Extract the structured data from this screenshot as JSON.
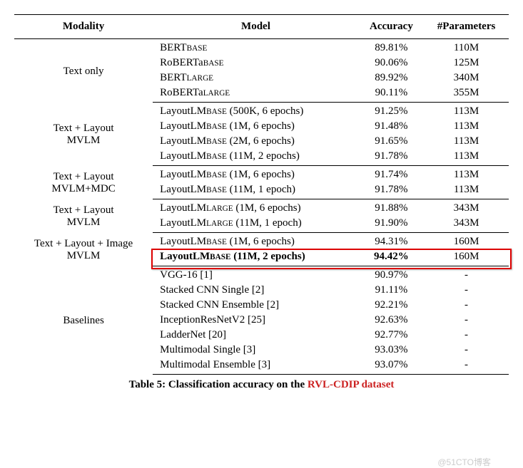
{
  "chart_data": {
    "type": "table",
    "columns": [
      "Modality",
      "Model",
      "Accuracy",
      "#Parameters"
    ],
    "groups": [
      {
        "modality": "Text only",
        "rows": [
          {
            "model_base": "BERT",
            "model_sub": "BASE",
            "detail": "",
            "acc": "89.81%",
            "params": "110M"
          },
          {
            "model_base": "RoBERTa",
            "model_sub": "BASE",
            "detail": "",
            "acc": "90.06%",
            "params": "125M"
          },
          {
            "model_base": "BERT",
            "model_sub": "LARGE",
            "detail": "",
            "acc": "89.92%",
            "params": "340M"
          },
          {
            "model_base": "RoBERTa",
            "model_sub": "LARGE",
            "detail": "",
            "acc": "90.11%",
            "params": "355M"
          }
        ]
      },
      {
        "modality": "Text + Layout\nMVLM",
        "rows": [
          {
            "model_base": "LayoutLM",
            "model_sub": "BASE",
            "detail": " (500K, 6 epochs)",
            "acc": "91.25%",
            "params": "113M"
          },
          {
            "model_base": "LayoutLM",
            "model_sub": "BASE",
            "detail": " (1M, 6 epochs)",
            "acc": "91.48%",
            "params": "113M"
          },
          {
            "model_base": "LayoutLM",
            "model_sub": "BASE",
            "detail": " (2M, 6 epochs)",
            "acc": "91.65%",
            "params": "113M"
          },
          {
            "model_base": "LayoutLM",
            "model_sub": "BASE",
            "detail": " (11M, 2 epochs)",
            "acc": "91.78%",
            "params": "113M"
          }
        ]
      },
      {
        "modality": "Text + Layout\nMVLM+MDC",
        "rows": [
          {
            "model_base": "LayoutLM",
            "model_sub": "BASE",
            "detail": " (1M, 6 epochs)",
            "acc": "91.74%",
            "params": "113M"
          },
          {
            "model_base": "LayoutLM",
            "model_sub": "BASE",
            "detail": " (11M, 1 epoch)",
            "acc": "91.78%",
            "params": "113M"
          }
        ]
      },
      {
        "modality": "Text + Layout\nMVLM",
        "rows": [
          {
            "model_base": "LayoutLM",
            "model_sub": "LARGE",
            "detail": " (1M, 6 epochs)",
            "acc": "91.88%",
            "params": "343M"
          },
          {
            "model_base": "LayoutLM",
            "model_sub": "LARGE",
            "detail": " (11M, 1 epoch)",
            "acc": "91.90%",
            "params": "343M"
          }
        ]
      },
      {
        "modality": "Text + Layout + Image\nMVLM",
        "rows": [
          {
            "model_base": "LayoutLM",
            "model_sub": "BASE",
            "detail": " (1M, 6 epochs)",
            "acc": "94.31%",
            "params": "160M"
          },
          {
            "model_base": "LayoutLM",
            "model_sub": "BASE",
            "detail": " (11M, 2 epochs)",
            "acc": "94.42%",
            "params": "160M",
            "bold": true,
            "highlight": true
          }
        ]
      },
      {
        "modality": "Baselines",
        "rows": [
          {
            "model_plain": "VGG-16 [1]",
            "acc": "90.97%",
            "params": "-"
          },
          {
            "model_plain": "Stacked CNN Single [2]",
            "acc": "91.11%",
            "params": "-"
          },
          {
            "model_plain": "Stacked CNN Ensemble [2]",
            "acc": "92.21%",
            "params": "-"
          },
          {
            "model_plain": "InceptionResNetV2 [25]",
            "acc": "92.63%",
            "params": "-"
          },
          {
            "model_plain": "LadderNet [20]",
            "acc": "92.77%",
            "params": "-"
          },
          {
            "model_plain": "Multimodal Single [3]",
            "acc": "93.03%",
            "params": "-"
          },
          {
            "model_plain": "Multimodal Ensemble [3]",
            "acc": "93.07%",
            "params": "-"
          }
        ]
      }
    ]
  },
  "caption_prefix": "Table 5: Classification accuracy on the ",
  "caption_dataset_red": "RVL-CDIP dataset",
  "watermark": "@51CTO博客"
}
